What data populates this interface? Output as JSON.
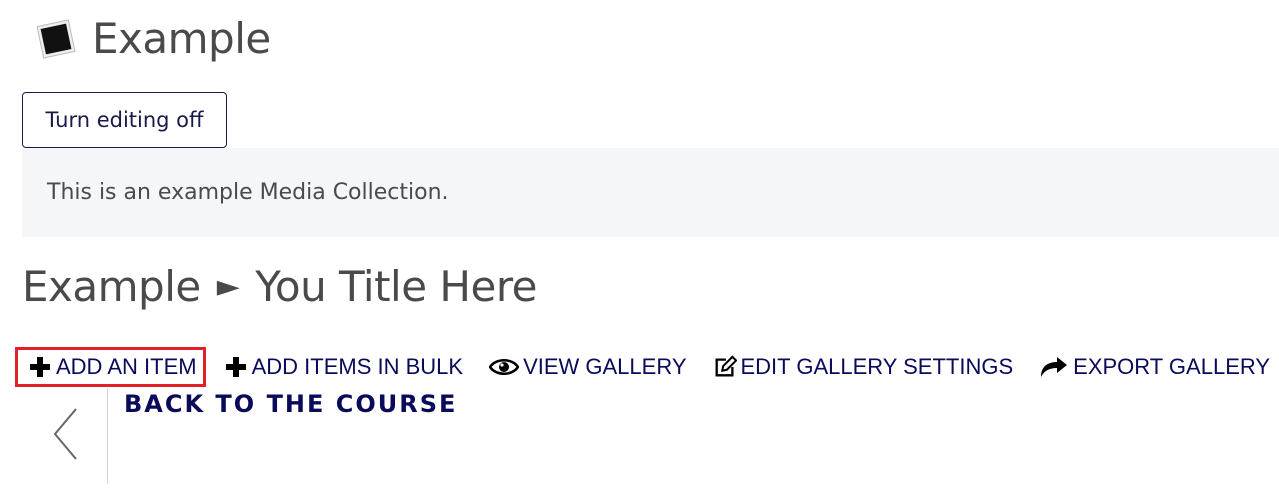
{
  "header": {
    "title": "Example",
    "logo_icon": "photo-frame-icon"
  },
  "edit_button": {
    "label": "Turn editing off"
  },
  "description": {
    "text": "This is an example Media Collection."
  },
  "breadcrumb": {
    "parent": "Example",
    "separator": "►",
    "current": "You Title Here"
  },
  "toolbar": {
    "items": [
      {
        "label": "ADD AN ITEM",
        "icon": "plus-icon",
        "highlighted": true
      },
      {
        "label": "ADD ITEMS IN BULK",
        "icon": "plus-icon",
        "highlighted": false
      },
      {
        "label": "VIEW GALLERY",
        "icon": "eye-icon",
        "highlighted": false
      },
      {
        "label": "EDIT GALLERY SETTINGS",
        "icon": "edit-icon",
        "highlighted": false
      },
      {
        "label": "EXPORT GALLERY",
        "icon": "share-arrow-icon",
        "highlighted": false
      }
    ]
  },
  "back": {
    "label": "BACK TO THE COURSE",
    "icon": "chevron-left-icon"
  },
  "colors": {
    "link": "#0a0a5a",
    "highlight_border": "#e3202a",
    "description_bg": "#f5f6f8"
  }
}
